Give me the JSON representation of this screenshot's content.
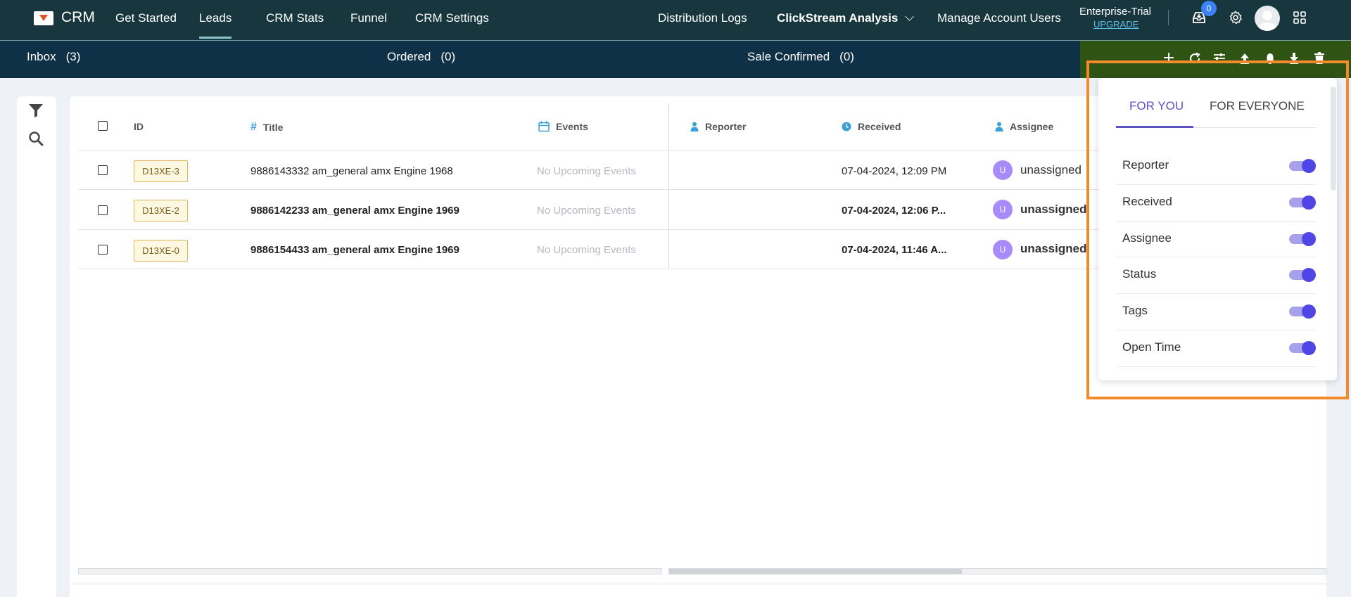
{
  "app": {
    "brand": "CRM"
  },
  "nav": {
    "get_started": "Get Started",
    "leads": "Leads",
    "crm_stats": "CRM Stats",
    "funnel": "Funnel",
    "crm_settings": "CRM Settings",
    "distribution_logs": "Distribution Logs",
    "clickstream": "ClickStream Analysis",
    "manage_users": "Manage Account Users",
    "plan": "Enterprise-Trial",
    "upgrade": "UPGRADE",
    "inbox_count": "0"
  },
  "subnav": {
    "inbox": {
      "label": "Inbox",
      "count": "(3)"
    },
    "ordered": {
      "label": "Ordered",
      "count": "(0)"
    },
    "sale_confirmed": {
      "label": "Sale Confirmed",
      "count": "(0)"
    }
  },
  "table": {
    "headers": {
      "id": "ID",
      "title": "Title",
      "events": "Events",
      "reporter": "Reporter",
      "received": "Received",
      "assignee": "Assignee"
    },
    "rows": [
      {
        "id": "D13XE-3",
        "title": "9886143332 am_general amx Engine 1968",
        "events": "No Upcoming Events",
        "received": "07-04-2024, 12:09 PM",
        "avatar": "U",
        "assignee": "unassigned"
      },
      {
        "id": "D13XE-2",
        "title": "9886142233 am_general amx Engine 1969",
        "events": "No Upcoming Events",
        "received": "07-04-2024, 12:06 P...",
        "avatar": "U",
        "assignee": "unassigned"
      },
      {
        "id": "D13XE-0",
        "title": "9886154433 am_general amx Engine 1969",
        "events": "No Upcoming Events",
        "received": "07-04-2024, 11:46 A...",
        "avatar": "U",
        "assignee": "unassigned"
      }
    ]
  },
  "column_panel": {
    "tabs": {
      "for_you": "FOR YOU",
      "for_everyone": "FOR EVERYONE"
    },
    "options": [
      {
        "label": "Reporter",
        "enabled": true
      },
      {
        "label": "Received",
        "enabled": true
      },
      {
        "label": "Assignee",
        "enabled": true
      },
      {
        "label": "Status",
        "enabled": true
      },
      {
        "label": "Tags",
        "enabled": true
      },
      {
        "label": "Open Time",
        "enabled": true
      }
    ]
  },
  "colors": {
    "topnav_bg": "#17363e",
    "subnav_bg": "#0f3147",
    "action_bar_bg": "#2f5313",
    "accent": "#5b52c8",
    "highlight": "#f28a2c"
  }
}
